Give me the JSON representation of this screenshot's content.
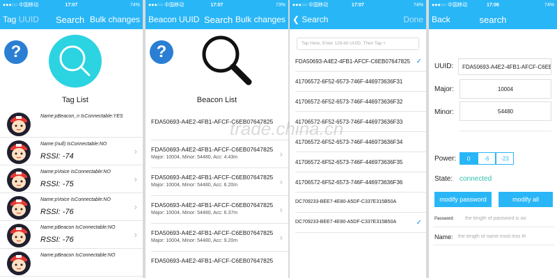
{
  "status": {
    "s1": {
      "carrier": "●●●○○ 中国移动 ",
      "time": "17:07",
      "right": "74%"
    },
    "s2": {
      "carrier": "●●●○○ 中国移动 ",
      "time": "17:07",
      "right": "73%"
    },
    "s3": {
      "carrier": "●●●○○ 中国移动 ",
      "time": "17:07",
      "right": "74%"
    },
    "s4": {
      "carrier": "●●●○○ 中国移动 ",
      "time": "17:06",
      "right": "74%"
    }
  },
  "screen1": {
    "nav_left_a": "Tag",
    "nav_left_b": "UUID",
    "nav_title": "Search",
    "nav_right": "Bulk changes",
    "help_label": "?",
    "list_title": "Tag List",
    "tags": [
      {
        "name": "Name:pBeacon_n  IsConnectable:YES",
        "rssi": ""
      },
      {
        "name": "Name:(null)  IsConnectable:NO",
        "rssi": "RSSI: -74"
      },
      {
        "name": "Name:pVoice  IsConnectable:NO",
        "rssi": "RSSI: -75"
      },
      {
        "name": "Name:pVoice  IsConnectable:NO",
        "rssi": "RSSI: -76"
      },
      {
        "name": "Name:pBeacon  IsConnectable:NO",
        "rssi": "RSSI: -76"
      },
      {
        "name": "Name:pBeacon  IsConnectable:NO",
        "rssi": ""
      }
    ]
  },
  "screen2": {
    "nav_left_a": "Beacon",
    "nav_left_b": "UUID",
    "nav_title": "Search",
    "nav_right": "Bulk changes",
    "help_label": "?",
    "list_title": "Beacon List",
    "beacons": [
      {
        "uuid": "FDA50693-A4E2-4FB1-AFCF-C6EB07647825",
        "detail": ""
      },
      {
        "uuid": "FDA50693-A4E2-4FB1-AFCF-C6EB07647825",
        "detail": "Major: 10004, Minor: 54480, Acc: 4.43m"
      },
      {
        "uuid": "FDA50693-A4E2-4FB1-AFCF-C6EB07647825",
        "detail": "Major: 10004, Minor: 54480, Acc: 6.20m"
      },
      {
        "uuid": "FDA50693-A4E2-4FB1-AFCF-C6EB07647825",
        "detail": "Major: 10004, Minor: 54480, Acc: 6.37m"
      },
      {
        "uuid": "FDA50693-A4E2-4FB1-AFCF-C6EB07647825",
        "detail": "Major: 10004, Minor: 54480, Acc: 9.20m"
      },
      {
        "uuid": "FDA50693-A4E2-4FB1-AFCF-C6EB07647825",
        "detail": ""
      }
    ]
  },
  "screen3": {
    "back_label": "Search",
    "done_label": "Done",
    "input_placeholder": "Tap Here, Enter 128-bit UUID, Then Tap +",
    "uuids": [
      {
        "text": "FDA50693-A4E2-4FB1-AFCF-C6EB07647825",
        "checked": true
      },
      {
        "text": "41706572-6F52-6573-746F-446973636F31",
        "checked": false
      },
      {
        "text": "41706572-6F52-6573-746F-446973636F32",
        "checked": false
      },
      {
        "text": "41706572-6F52-6573-746F-446973636F33",
        "checked": false
      },
      {
        "text": "41706572-6F52-6573-746F-446973636F34",
        "checked": false
      },
      {
        "text": "41706572-6F52-6573-746F-446973636F35",
        "checked": false
      },
      {
        "text": "41706572-6F52-6573-746F-446973636F36",
        "checked": false
      },
      {
        "text": "DC709233-BEE7-4E80-A5DF-C337E315B50A",
        "checked": false
      },
      {
        "text": "DC709233-BEE7-4E80-A5DF-C337E315B50A",
        "checked": true
      }
    ]
  },
  "screen4": {
    "back_label": "Back",
    "nav_title": "search",
    "uuid_label": "UUID:",
    "uuid_value": "FDA50693-A4E2-4FB1-AFCF-C6EB",
    "major_label": "Major:",
    "major_value": "10004",
    "minor_label": "Minor:",
    "minor_value": "54480",
    "power_label": "Power:",
    "power_options": [
      "0",
      "-6",
      "-23"
    ],
    "state_label": "State:",
    "state_value": "connected",
    "modify_password_label": "modify password",
    "modify_all_label": "modify all",
    "password_label": "Password:",
    "password_placeholder": "the length of password is six",
    "name_label": "Name:",
    "name_placeholder": "the length of name most less th"
  },
  "watermark": "trade.china.cn",
  "colors": {
    "accent": "#29b6f6",
    "help": "#2a7fd4",
    "tag_circle": "#2cd3e1",
    "state": "#2fbfae"
  }
}
